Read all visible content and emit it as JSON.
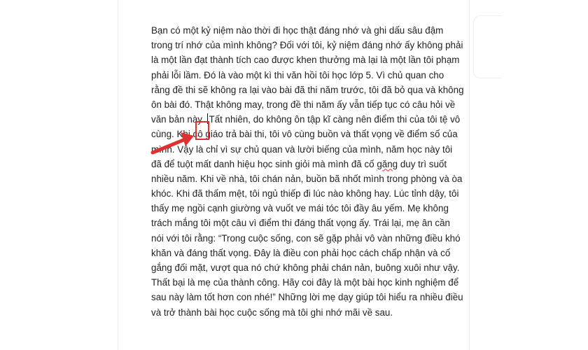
{
  "document": {
    "lines": {
      "l1": "Bạn có một kỷ niệm nào thời đi học thật đáng nhớ và ghi dấu sâu đậm",
      "l2": "trong trí nhớ của mình không? Đối với tôi, kỷ niệm đáng nhớ ấy không phải",
      "l3": "là một lần đạt thành tích cao được khen thưởng mà lại là một lần tôi phạm",
      "l4": "phải lỗi lầm. Đó là vào một kì thi văn hồi tôi học lớp 5. Vì chủ quan cho",
      "l5": "rằng đề thi sẽ không ra lại vào bài đã thi năm trước, tôi đã bỏ qua và không",
      "l6": "ôn bài đó. Thật không may, trong đề thi năm ấy vẫn tiếp tục có câu hỏi về",
      "l7a": "văn bản này.",
      "l7b": "Tất nhiên, do không ôn tập kĩ càng nên điểm thi của tôi tệ vô",
      "l8": "cùng. Khi cô giáo trả bài thi, tôi vô cùng buồn và thất vọng về điểm số của",
      "l9": "mình. Vậy là chỉ vì sự chủ quan và lười biếng của mình, năm học này tôi",
      "l10a": "đã để tuột mất danh hiệu học sinh giỏi mà mình đã cố ",
      "l10b": "găng",
      "l10c": " duy trì suốt",
      "l11": "nhiều năm. Khi về nhà, tôi chán nản, buồn bã nhốt mình trong phòng và òa",
      "l12": "khóc. Khi đã thấm mệt, tôi ngủ thiếp đi lúc nào không hay. Lúc tỉnh dậy, tôi",
      "l13": "thấy mẹ ngồi cạnh giường và vuốt ve mái tóc tôi đầy âu yếm. Mẹ không",
      "l14": "trách mắng tôi một câu vì điểm thi đáng thất vọng ấy. Trái lại, mẹ ân cần",
      "l15": "nói với tôi rằng: “Trong cuộc sống, con sẽ gặp phải vô vàn những điều khó",
      "l16": "khăn và đáng thất vọng. Đây là điều con phải học cách chấp nhận và cố",
      "l17": "gắng đối mặt, vượt qua nó chứ không phải chán nản, buông xuôi như vậy.",
      "l18": "Thất bại là mẹ của thành công. Hãy coi đây là một bài học kinh nghiệm để",
      "l19": "sau này làm tốt hơn con nhé!” Những lời mẹ dạy giúp tôi hiểu ra nhiều điều",
      "l20": "và trở thành bài học cuộc sống mà tôi ghi nhớ mãi về sau."
    }
  },
  "colors": {
    "annotation": "#e03030",
    "spellcheck_underline": "#dd3333",
    "text": "#222222"
  },
  "icons": {
    "annotation_arrow": "red-arrow-icon",
    "cursor": "text-caret"
  }
}
